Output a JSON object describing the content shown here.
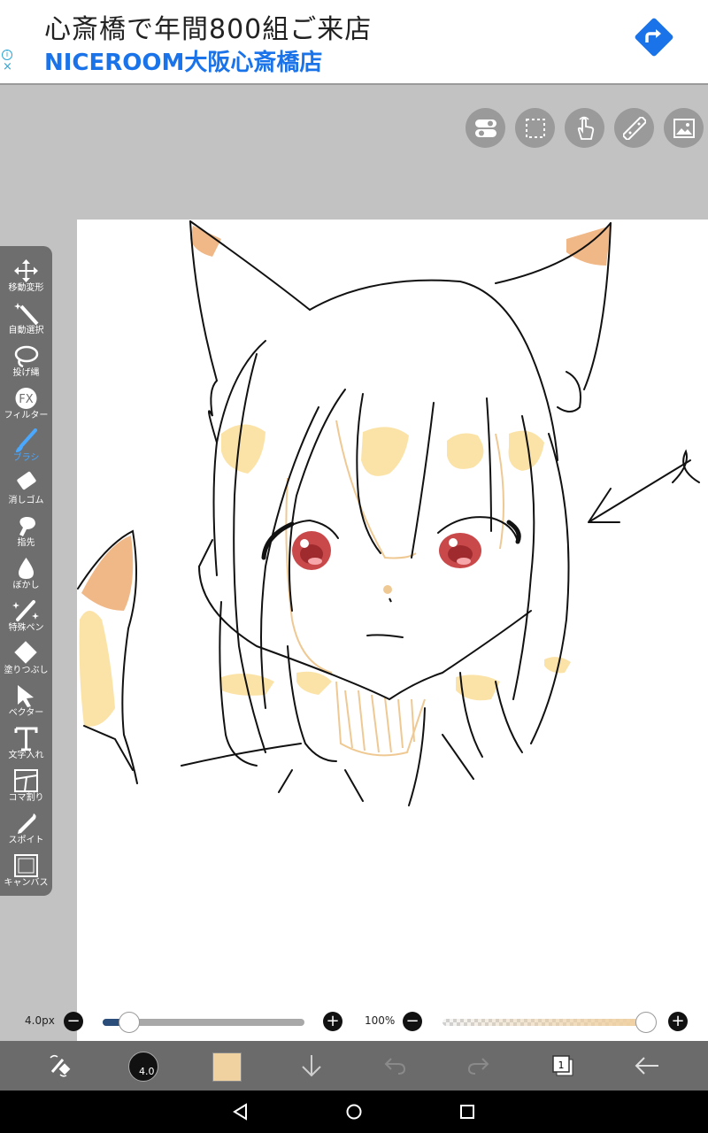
{
  "ad": {
    "title": "心斎橋で年間800組ご来店",
    "subtitle": "NICEROOM大阪心斎橋店",
    "info_glyph": "i",
    "close_glyph": "×",
    "accent": "#1a73e8"
  },
  "top_tools": [
    {
      "name": "toggle-icon"
    },
    {
      "name": "selection-icon"
    },
    {
      "name": "hand-icon"
    },
    {
      "name": "ruler-icon"
    },
    {
      "name": "image-icon"
    }
  ],
  "tools": [
    {
      "label": "移動変形",
      "icon": "move-icon"
    },
    {
      "label": "自動選択",
      "icon": "magic-wand-icon"
    },
    {
      "label": "投げ縄",
      "icon": "lasso-icon"
    },
    {
      "label": "フィルター",
      "icon": "fx-icon"
    },
    {
      "label": "ブラシ",
      "icon": "brush-icon",
      "active": true
    },
    {
      "label": "消しゴム",
      "icon": "eraser-icon"
    },
    {
      "label": "指先",
      "icon": "finger-icon"
    },
    {
      "label": "ぼかし",
      "icon": "blur-icon"
    },
    {
      "label": "特殊ペン",
      "icon": "special-pen-icon"
    },
    {
      "label": "塗りつぶし",
      "icon": "fill-icon"
    },
    {
      "label": "ベクター",
      "icon": "vector-icon"
    },
    {
      "label": "文字入れ",
      "icon": "text-icon"
    },
    {
      "label": "コマ割り",
      "icon": "frame-icon"
    },
    {
      "label": "スポイト",
      "icon": "eyedropper-icon"
    },
    {
      "label": "キャンバス",
      "icon": "canvas-icon"
    }
  ],
  "sliders": {
    "brush_size": "4.0px",
    "brush_size_fraction": 0.13,
    "opacity": "100%",
    "opacity_fraction": 1.0,
    "minus_glyph": "−",
    "plus_glyph": "+"
  },
  "bottom": {
    "brush_size_display": "4.0",
    "color": "#f0d2a0",
    "layer_count": "1"
  }
}
